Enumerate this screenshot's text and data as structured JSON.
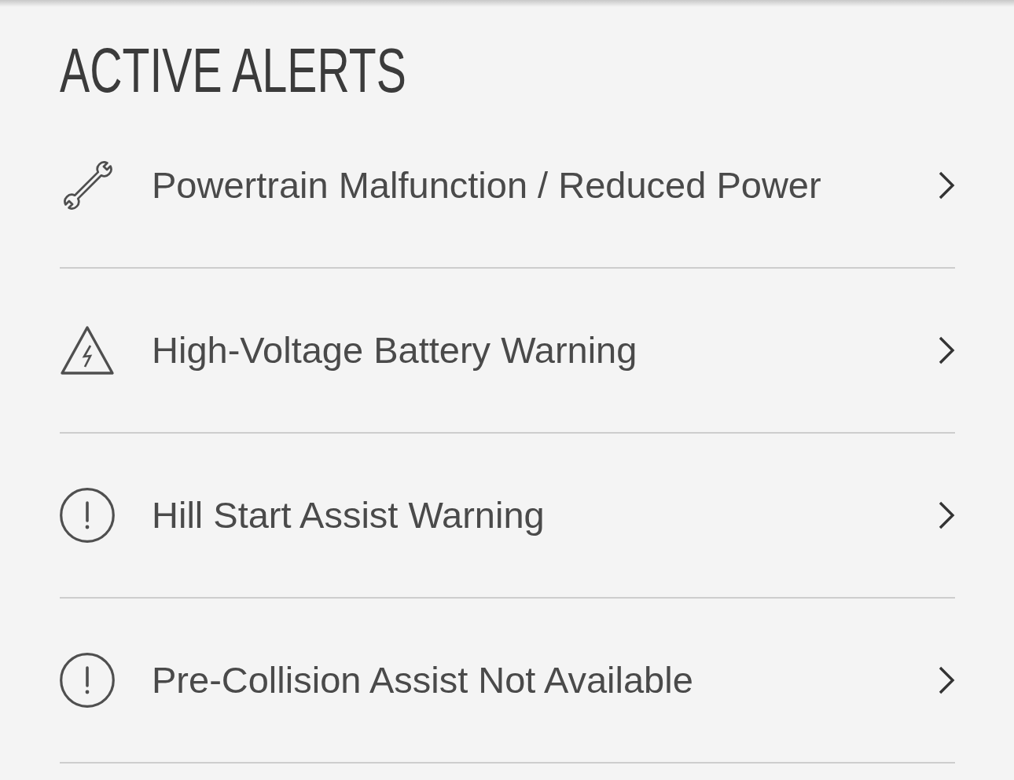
{
  "title": "ACTIVE ALERTS",
  "alerts": [
    {
      "kind": "wrench",
      "label": "Powertrain Malfunction / Reduced Power"
    },
    {
      "kind": "high-voltage",
      "label": "High-Voltage Battery Warning"
    },
    {
      "kind": "exclamation",
      "label": "Hill Start Assist Warning"
    },
    {
      "kind": "exclamation",
      "label": "Pre-Collision Assist Not Available"
    }
  ]
}
